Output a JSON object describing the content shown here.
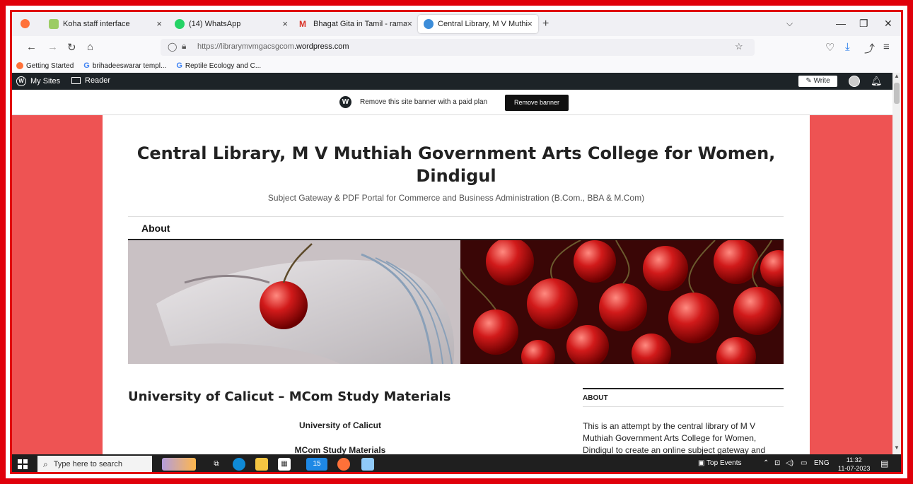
{
  "tabs": [
    {
      "title": "Koha staff interface",
      "close": "×"
    },
    {
      "title": "(14) WhatsApp",
      "close": "×"
    },
    {
      "title": "Bhagat Gita in Tamil - ramasam",
      "close": "×"
    },
    {
      "title": "Central Library, M V Muthiah G",
      "close": "×"
    }
  ],
  "tab_new": "+",
  "url": {
    "prefix": "https://",
    "domain": "librarymvmgacsgcom",
    "suffix": ".wordpress.com"
  },
  "bookmarks": [
    "Getting Started",
    "brihadeeswarar templ...",
    "Reptile Ecology and C..."
  ],
  "wpbar": {
    "my_sites": "My Sites",
    "reader": "Reader",
    "write": "Write"
  },
  "banner": {
    "text": "Remove this site banner with a paid plan",
    "button": "Remove banner"
  },
  "site": {
    "title": "Central Library, M V Muthiah Government Arts College for Women, Dindigul",
    "description": "Subject Gateway & PDF Portal for Commerce and Business Administration (B.Com., BBA & M.Com)",
    "menu_about": "About"
  },
  "post": {
    "title": "University of Calicut – MCom Study Materials",
    "line1": "University of Calicut",
    "line2": "MCom Study Materials"
  },
  "widget": {
    "title": "ABOUT",
    "text": "This is an attempt by the central library of M V Muthiah Government Arts College for Women, Dindigul to create an online subject gateway and"
  },
  "taskbar": {
    "search_placeholder": "Type here to search",
    "mail_badge": "15",
    "weather": "Top Events",
    "lang": "ENG",
    "time": "11:32",
    "date": "11-07-2023"
  },
  "colors": {
    "frame": "#e0000a",
    "site_bg": "#ee5353",
    "wpbar": "#1d2327"
  }
}
